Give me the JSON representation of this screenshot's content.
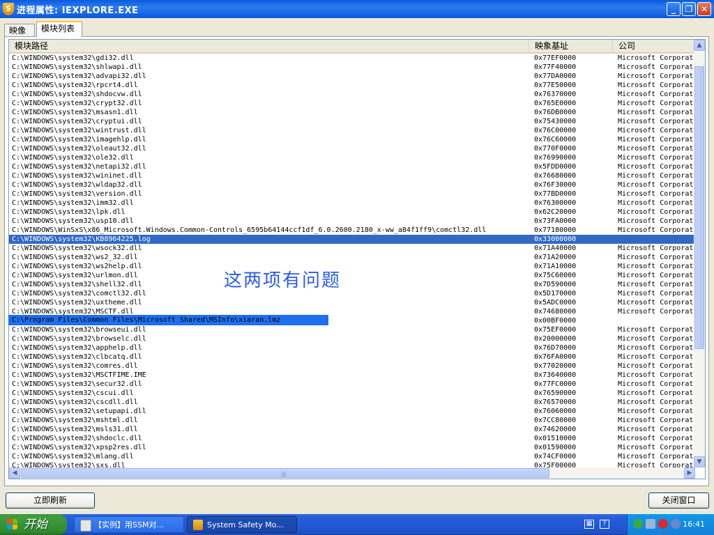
{
  "window": {
    "title": "进程属性: IEXPLORE.EXE",
    "minimize": "_",
    "maximize": "❐",
    "close": "✕"
  },
  "tabs": [
    {
      "label": "映像",
      "active": false
    },
    {
      "label": "模块列表",
      "active": true
    }
  ],
  "table": {
    "columns": [
      "模块路径",
      "映象基址",
      "公司"
    ],
    "selected_row_index": 20,
    "rows": [
      [
        "C:\\WINDOWS\\system32\\gdi32.dll",
        "0x77EF0000",
        "Microsoft Corporat:"
      ],
      [
        "C:\\WINDOWS\\system32\\shlwapi.dll",
        "0x77F40000",
        "Microsoft Corporat:"
      ],
      [
        "C:\\WINDOWS\\system32\\advapi32.dll",
        "0x77DA0000",
        "Microsoft Corporat:"
      ],
      [
        "C:\\WINDOWS\\system32\\rpcrt4.dll",
        "0x77E50000",
        "Microsoft Corporat:"
      ],
      [
        "C:\\WINDOWS\\system32\\shdocvw.dll",
        "0x76370000",
        "Microsoft Corporat:"
      ],
      [
        "C:\\WINDOWS\\system32\\crypt32.dll",
        "0x765E0000",
        "Microsoft Corporat:"
      ],
      [
        "C:\\WINDOWS\\system32\\msasn1.dll",
        "0x76DB0000",
        "Microsoft Corporat:"
      ],
      [
        "C:\\WINDOWS\\system32\\cryptui.dll",
        "0x75430000",
        "Microsoft Corporat:"
      ],
      [
        "C:\\WINDOWS\\system32\\wintrust.dll",
        "0x76C00000",
        "Microsoft Corporat:"
      ],
      [
        "C:\\WINDOWS\\system32\\imagehlp.dll",
        "0x76C60000",
        "Microsoft Corporat:"
      ],
      [
        "C:\\WINDOWS\\system32\\oleaut32.dll",
        "0x770F0000",
        "Microsoft Corporat:"
      ],
      [
        "C:\\WINDOWS\\system32\\ole32.dll",
        "0x76990000",
        "Microsoft Corporat:"
      ],
      [
        "C:\\WINDOWS\\system32\\netapi32.dll",
        "0x5FDD0000",
        "Microsoft Corporat:"
      ],
      [
        "C:\\WINDOWS\\system32\\wininet.dll",
        "0x76680000",
        "Microsoft Corporat:"
      ],
      [
        "C:\\WINDOWS\\system32\\wldap32.dll",
        "0x76F30000",
        "Microsoft Corporat:"
      ],
      [
        "C:\\WINDOWS\\system32\\version.dll",
        "0x77BD0000",
        "Microsoft Corporat:"
      ],
      [
        "C:\\WINDOWS\\system32\\imm32.dll",
        "0x76300000",
        "Microsoft Corporat:"
      ],
      [
        "C:\\WINDOWS\\system32\\lpk.dll",
        "0x62C20000",
        "Microsoft Corporat:"
      ],
      [
        "C:\\WINDOWS\\system32\\usp10.dll",
        "0x73FA0000",
        "Microsoft Corporat:"
      ],
      [
        "C:\\WINDOWS\\WinSxS\\x86_Microsoft.Windows.Common-Controls_6595b64144ccf1df_6.0.2600.2180_x-ww_a84f1ff9\\comctl32.dll",
        "0x77180000",
        "Microsoft Corporat:"
      ],
      [
        "C:\\WINDOWS\\system32\\KB8964225.log",
        "0x33000000",
        ""
      ],
      [
        "C:\\WINDOWS\\system32\\wsock32.dll",
        "0x71A40000",
        "Microsoft Corporat:"
      ],
      [
        "C:\\WINDOWS\\system32\\ws2_32.dll",
        "0x71A20000",
        "Microsoft Corporat:"
      ],
      [
        "C:\\WINDOWS\\system32\\ws2help.dll",
        "0x71A10000",
        "Microsoft Corporat:"
      ],
      [
        "C:\\WINDOWS\\system32\\urlmon.dll",
        "0x75C60000",
        "Microsoft Corporat:"
      ],
      [
        "C:\\WINDOWS\\system32\\shell32.dll",
        "0x7D590000",
        "Microsoft Corporat:"
      ],
      [
        "C:\\WINDOWS\\system32\\comctl32.dll",
        "0x5D170000",
        "Microsoft Corporat:"
      ],
      [
        "C:\\WINDOWS\\system32\\uxtheme.dll",
        "0x5ADC0000",
        "Microsoft Corporat:"
      ],
      [
        "C:\\WINDOWS\\system32\\MSCTF.dll",
        "0x74680000",
        "Microsoft Corporat:"
      ],
      [
        "C:\\Program Files\\Common Files\\Microsoft Shared\\MSInfo\\xiaran.lmz",
        "0x00BF0000",
        ""
      ],
      [
        "C:\\WINDOWS\\system32\\browseui.dll",
        "0x75EF0000",
        "Microsoft Corporat:"
      ],
      [
        "C:\\WINDOWS\\system32\\browselc.dll",
        "0x20000000",
        "Microsoft Corporat:"
      ],
      [
        "C:\\WINDOWS\\system32\\apphelp.dll",
        "0x76D70000",
        "Microsoft Corporat:"
      ],
      [
        "C:\\WINDOWS\\system32\\clbcatq.dll",
        "0x76FA0000",
        "Microsoft Corporat:"
      ],
      [
        "C:\\WINDOWS\\system32\\comres.dll",
        "0x77020000",
        "Microsoft Corporat:"
      ],
      [
        "C:\\WINDOWS\\system32\\MSCTFIME.IME",
        "0x73640000",
        "Microsoft Corporat:"
      ],
      [
        "C:\\WINDOWS\\system32\\secur32.dll",
        "0x77FC0000",
        "Microsoft Corporat:"
      ],
      [
        "C:\\WINDOWS\\system32\\cscui.dll",
        "0x76590000",
        "Microsoft Corporat:"
      ],
      [
        "C:\\WINDOWS\\system32\\cscdll.dll",
        "0x76570000",
        "Microsoft Corporat:"
      ],
      [
        "C:\\WINDOWS\\system32\\setupapi.dll",
        "0x76060000",
        "Microsoft Corporat:"
      ],
      [
        "C:\\WINDOWS\\system32\\mshtml.dll",
        "0x7CC80000",
        "Microsoft Corporat:"
      ],
      [
        "C:\\WINDOWS\\system32\\msls31.dll",
        "0x74620000",
        "Microsoft Corporat:"
      ],
      [
        "C:\\WINDOWS\\system32\\shdoclc.dll",
        "0x01510000",
        "Microsoft Corporat:"
      ],
      [
        "C:\\WINDOWS\\system32\\xpsp2res.dll",
        "0x01590000",
        "Microsoft Corporat:"
      ],
      [
        "C:\\WINDOWS\\system32\\mlang.dll",
        "0x74CF0000",
        "Microsoft Corporat:"
      ],
      [
        "C:\\WINDOWS\\system32\\sxs.dll",
        "0x75F00000",
        "Microsoft Corporat:"
      ]
    ]
  },
  "annotation": "这两项有问题",
  "highlighted_path": "C:\\Program Files\\Common Files\\Microsoft Shared\\MSInfo\\xiaran.lmz",
  "buttons": {
    "refresh": "立即刷新",
    "close_window": "关闭窗口"
  },
  "taskbar": {
    "start_label": "开始",
    "tasks": [
      {
        "label": "【实例】用SSM对..."
      },
      {
        "label": "System Safety Mo..."
      }
    ],
    "clock": "16:41"
  },
  "icons": {
    "app": "shield-app-icon",
    "scroll_up": "arrow-up-icon",
    "scroll_down": "arrow-down-icon",
    "scroll_left": "arrow-left-icon",
    "scroll_right": "arrow-right-icon",
    "start": "windows-logo-icon"
  },
  "colors": {
    "selection": "#316AC5",
    "annotation": "#2B5CE6",
    "titlebar": "#0A5BE0"
  }
}
